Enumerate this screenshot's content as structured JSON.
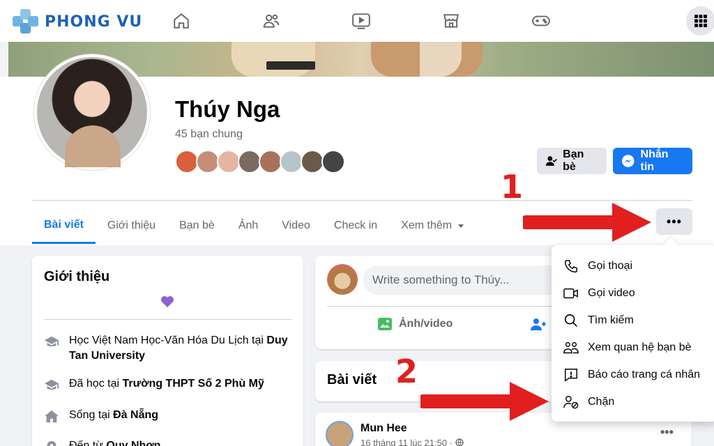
{
  "brand": {
    "logo_text": "PHONG VU",
    "accent": "#1877f2"
  },
  "topnav": {
    "icons": [
      "home-icon",
      "friends-icon",
      "watch-icon",
      "marketplace-icon",
      "gaming-icon",
      "menu-grid-icon"
    ]
  },
  "profile": {
    "name": "Thúy Nga",
    "mutual_friends": "45 bạn chung",
    "friend_button": "Bạn bè",
    "message_button": "Nhắn tin"
  },
  "tabs": [
    {
      "label": "Bài viết",
      "active": true
    },
    {
      "label": "Giới thiệu"
    },
    {
      "label": "Bạn bè"
    },
    {
      "label": "Ảnh"
    },
    {
      "label": "Video"
    },
    {
      "label": "Check in"
    },
    {
      "label": "Xem thêm"
    }
  ],
  "more_button": "•••",
  "intro": {
    "title": "Giới thiệu",
    "items": [
      {
        "prefix": "Học Việt Nam Học-Văn Hóa Du Lịch tại ",
        "bold": "Duy Tan University",
        "icon": "school-icon"
      },
      {
        "prefix": "Đã học tại ",
        "bold": "Trường THPT Số 2 Phù Mỹ",
        "icon": "school-icon"
      },
      {
        "prefix": "Sống tại ",
        "bold": "Đà Nẵng",
        "icon": "home-icon"
      },
      {
        "prefix": "Đến từ ",
        "bold": "Quy Nhơn",
        "icon": "location-icon"
      }
    ]
  },
  "composer": {
    "placeholder": "Write something to Thúy...",
    "photo_action": "Ảnh/video"
  },
  "posts": {
    "title": "Bài viết"
  },
  "post": {
    "author": "Mun Hee",
    "date": "16 tháng 11 lúc 21:50 ·",
    "more": "•••"
  },
  "menu": {
    "items": [
      {
        "label": "Gọi thoại",
        "icon": "phone-icon"
      },
      {
        "label": "Gọi video",
        "icon": "video-camera-icon"
      },
      {
        "label": "Tìm kiếm",
        "icon": "search-icon"
      },
      {
        "label": "Xem quan hệ bạn bè",
        "icon": "friendship-icon"
      },
      {
        "label": "Báo cáo trang cá nhân",
        "icon": "report-icon"
      },
      {
        "label": "Chặn",
        "icon": "block-user-icon"
      }
    ]
  },
  "annotations": {
    "step1": "1",
    "step2": "2",
    "color": "#e11f1f"
  }
}
